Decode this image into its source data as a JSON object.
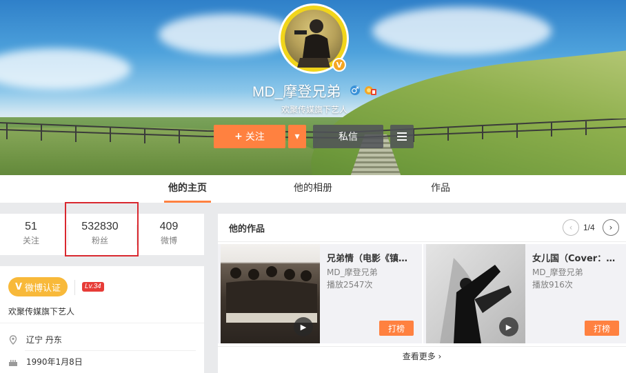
{
  "profile": {
    "username": "MD_摩登兄弟",
    "subtitle": "欢聚传媒旗下艺人",
    "verified_badge": "V",
    "gender_icon": "male-icon",
    "gender_symbol": "♂"
  },
  "actions": {
    "follow_label": "关注",
    "follow_plus": "+",
    "dropdown_symbol": "▾",
    "message_label": "私信",
    "more_symbol": "≡"
  },
  "tabs": [
    {
      "label": "他的主页",
      "active": true
    },
    {
      "label": "他的相册",
      "active": false
    },
    {
      "label": "作品",
      "active": false
    }
  ],
  "stats": [
    {
      "value": "51",
      "label": "关注"
    },
    {
      "value": "532830",
      "label": "粉丝"
    },
    {
      "value": "409",
      "label": "微博"
    }
  ],
  "info": {
    "cert_v": "V",
    "cert_label": "微博认证",
    "level": "Lv.34",
    "description": "欢聚传媒旗下艺人",
    "location_icon": "location-pin-icon",
    "location": "辽宁 丹东",
    "birthday_icon": "cake-icon",
    "birthday": "1990年1月8日"
  },
  "works": {
    "title": "他的作品",
    "pager": "1/4",
    "prev_symbol": "‹",
    "next_symbol": "›",
    "items": [
      {
        "title": "兄弟情（电影《镇魂法师》",
        "author": "MD_摩登兄弟",
        "plays": "播放2547次",
        "rank_label": "打榜"
      },
      {
        "title": "女儿国（Cover：李健）",
        "author": "MD_摩登兄弟",
        "plays": "播放916次",
        "rank_label": "打榜"
      }
    ],
    "see_more": "查看更多 ›",
    "play_symbol": "▶"
  },
  "colors": {
    "accent": "#ff8140",
    "highlight_border": "#d9272e",
    "level_badge": "#e73c37",
    "cert_badge": "#f8b93a"
  }
}
